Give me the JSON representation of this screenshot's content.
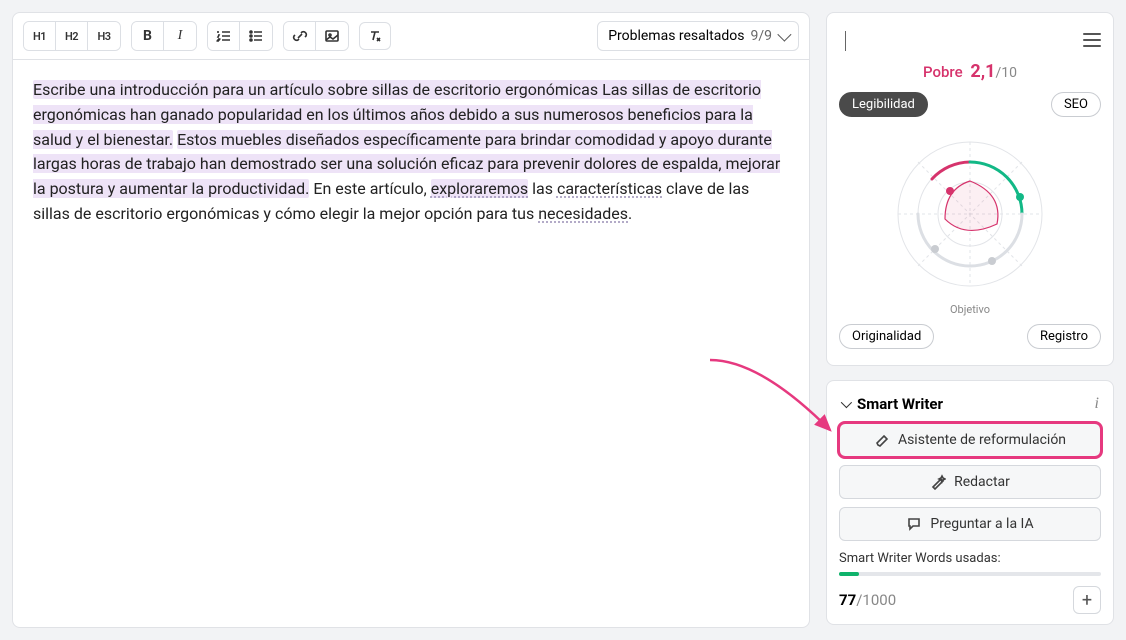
{
  "toolbar": {
    "h1": "H1",
    "h2": "H2",
    "h3": "H3",
    "problems_label": "Problemas resaltados",
    "problems_count": "9/9"
  },
  "editor": {
    "seg1": "Escribe una introducción para un artículo sobre sillas de escritorio ergonómicas Las sillas de escritorio ergonómicas han ganado popularidad en los últimos años debido a sus numerosos beneficios para la salud y el bienestar.",
    "seg2": " ",
    "seg3": "Estos muebles diseñados específicamente para brindar comodidad y apoyo durante largas horas de trabajo han demostrado ser una solución eficaz para prevenir dolores de espalda, mejorar la postura y aumentar la productividad.",
    "seg4": " En este artículo, ",
    "seg5": "exploraremos",
    "seg6": " las ",
    "seg7": "características",
    "seg8": " clave de las sillas de escritorio ergonómicas y cómo elegir la mejor opción para tus ",
    "seg9": "necesidades",
    "seg10": "."
  },
  "score": {
    "label": "Pobre",
    "value": "2,1",
    "max": "/10"
  },
  "chips": {
    "top_left": "Legibilidad",
    "top_right": "SEO",
    "bottom_left": "Originalidad",
    "bottom_right": "Registro"
  },
  "radar": {
    "caption": "Objetivo"
  },
  "smart_writer": {
    "title": "Smart Writer",
    "btn_reword": "Asistente de reformulación",
    "btn_compose": "Redactar",
    "btn_ask": "Preguntar a la IA",
    "usage_label": "Smart Writer Words usadas:",
    "usage_used": "77",
    "usage_total": "/1000",
    "usage_pct": 7.7
  }
}
